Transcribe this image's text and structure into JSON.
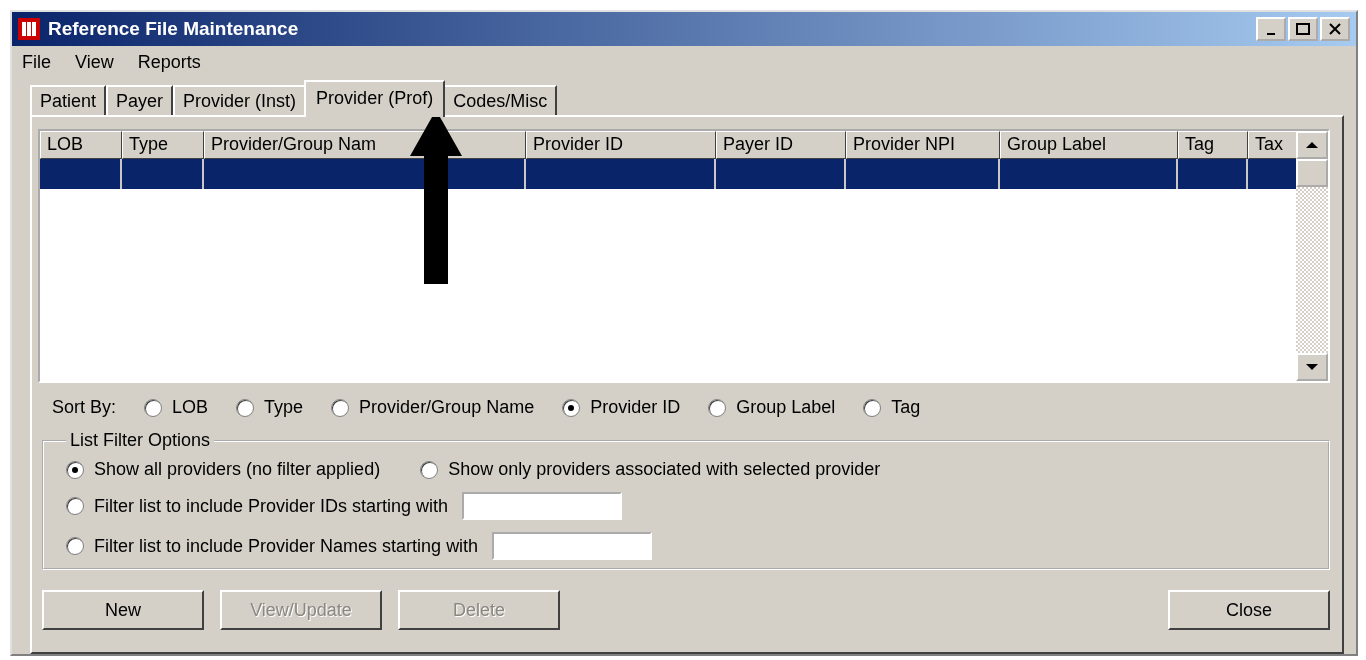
{
  "window": {
    "title": "Reference File Maintenance"
  },
  "menu": [
    "File",
    "View",
    "Reports"
  ],
  "tabs": [
    {
      "label": "Patient",
      "selected": false
    },
    {
      "label": "Payer",
      "selected": false
    },
    {
      "label": "Provider (Inst)",
      "selected": false
    },
    {
      "label": "Provider (Prof)",
      "selected": true
    },
    {
      "label": "Codes/Misc",
      "selected": false
    }
  ],
  "table": {
    "columns": [
      "LOB",
      "Type",
      "Provider/Group Nam",
      "Provider ID",
      "Payer ID",
      "Provider NPI",
      "Group Label",
      "Tag",
      "Tax"
    ],
    "rows": [
      {
        "selected": true
      }
    ]
  },
  "sort_by": {
    "label": "Sort By:",
    "options": [
      {
        "label": "LOB",
        "selected": false
      },
      {
        "label": "Type",
        "selected": false
      },
      {
        "label": "Provider/Group Name",
        "selected": false
      },
      {
        "label": "Provider ID",
        "selected": true
      },
      {
        "label": "Group Label",
        "selected": false
      },
      {
        "label": "Tag",
        "selected": false
      }
    ]
  },
  "filter": {
    "title": "List Filter Options",
    "options": [
      {
        "label": "Show all providers (no filter applied)",
        "selected": true,
        "kind": "plain"
      },
      {
        "label": "Show only providers associated with selected provider",
        "selected": false,
        "kind": "plain"
      },
      {
        "label": "Filter list to include Provider IDs starting with",
        "selected": false,
        "kind": "input"
      },
      {
        "label": "Filter list to include Provider Names starting with",
        "selected": false,
        "kind": "input"
      }
    ]
  },
  "buttons": [
    {
      "label": "New",
      "disabled": false
    },
    {
      "label": "View/Update",
      "disabled": true
    },
    {
      "label": "Delete",
      "disabled": true
    },
    {
      "label": "Close",
      "disabled": false
    }
  ],
  "annotation": {
    "kind": "arrow"
  }
}
